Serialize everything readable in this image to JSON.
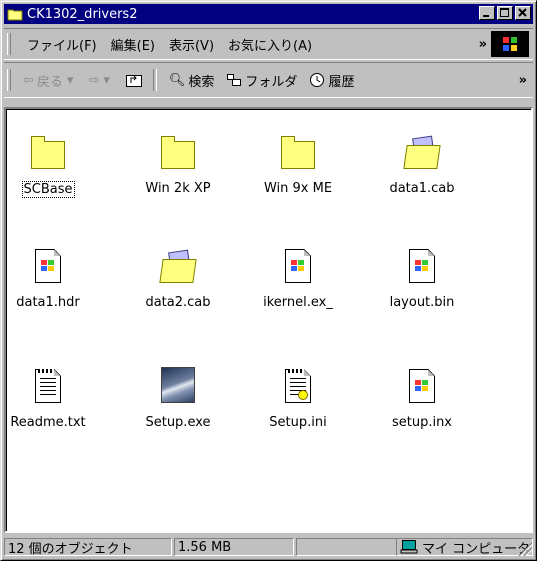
{
  "window": {
    "title": "CK1302_drivers2",
    "icon": "folder-icon",
    "accent_color": "#000080"
  },
  "menu": {
    "items": [
      "ファイル(F)",
      "編集(E)",
      "表示(V)",
      "お気に入り(A)"
    ],
    "more": "»"
  },
  "toolbar": {
    "back_label": "戻る",
    "forward_label": "⇨",
    "search_label": "検索",
    "folders_label": "フォルダ",
    "history_label": "履歴",
    "more": "»"
  },
  "files": [
    {
      "name": "SCBase",
      "type": "folder"
    },
    {
      "name": "Win 2k XP",
      "type": "folder"
    },
    {
      "name": "Win 9x ME",
      "type": "folder"
    },
    {
      "name": "data1.cab",
      "type": "cab"
    },
    {
      "name": "data1.hdr",
      "type": "windows-file"
    },
    {
      "name": "data2.cab",
      "type": "cab"
    },
    {
      "name": "ikernel.ex_",
      "type": "windows-file"
    },
    {
      "name": "layout.bin",
      "type": "windows-file"
    },
    {
      "name": "Readme.txt",
      "type": "text"
    },
    {
      "name": "Setup.exe",
      "type": "setup-exe"
    },
    {
      "name": "Setup.ini",
      "type": "ini"
    },
    {
      "name": "setup.inx",
      "type": "windows-file"
    }
  ],
  "status": {
    "objects": "12 個のオブジェクト",
    "size": "1.56 MB",
    "zone": "マイ コンピュータ"
  }
}
